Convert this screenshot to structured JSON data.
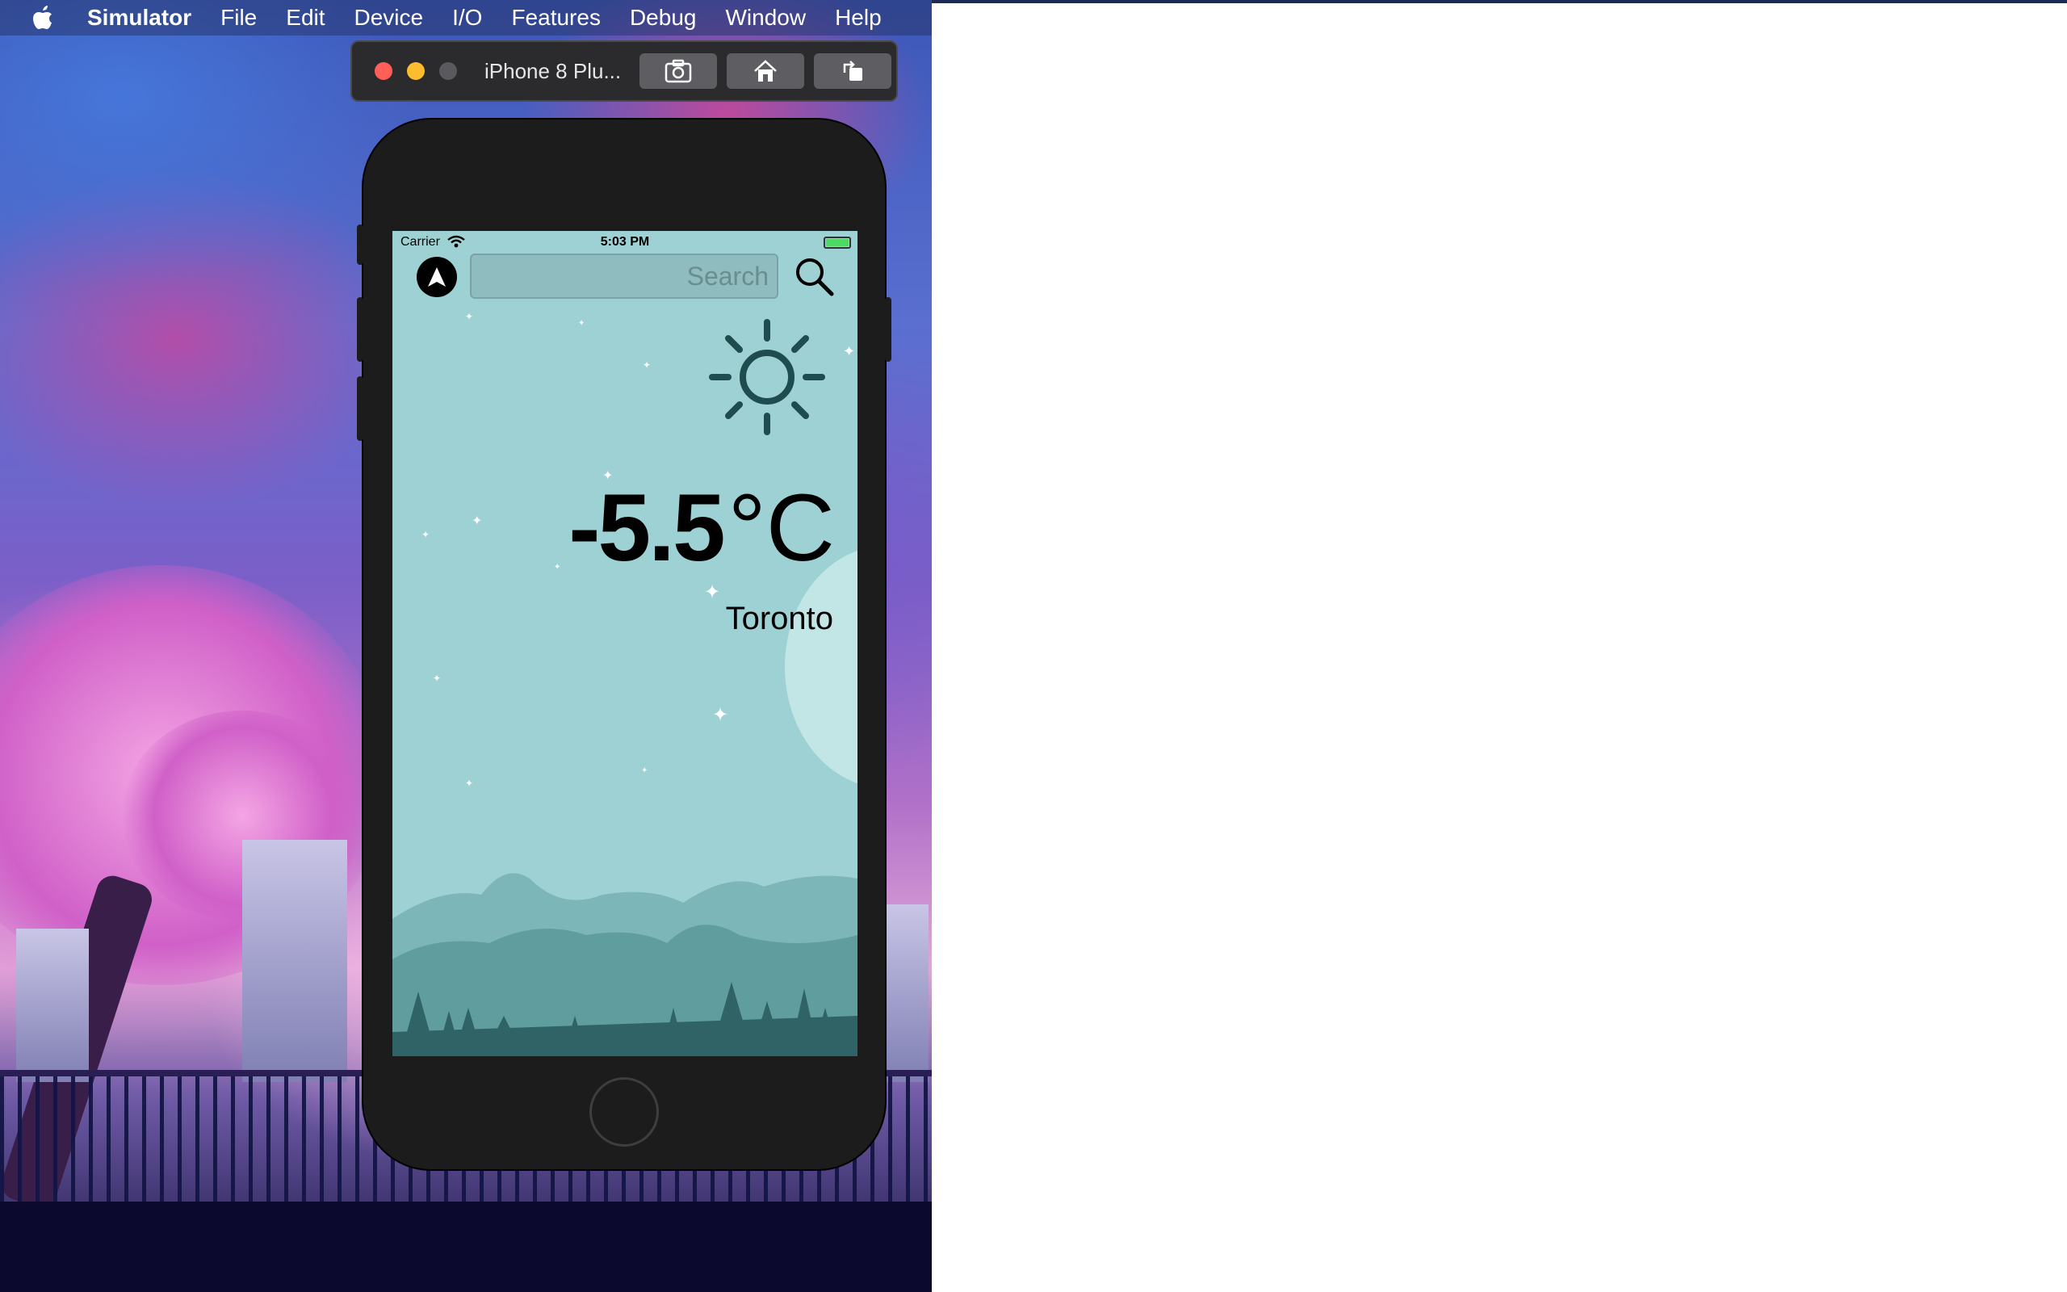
{
  "menubar": {
    "app_name": "Simulator",
    "items": [
      "File",
      "Edit",
      "Device",
      "I/O",
      "Features",
      "Debug",
      "Window",
      "Help"
    ]
  },
  "simulator": {
    "device_title": "iPhone 8 Plu...",
    "buttons": [
      "screenshot-icon",
      "home-icon",
      "rotate-icon"
    ]
  },
  "status_bar": {
    "carrier": "Carrier",
    "time": "5:03 PM"
  },
  "app": {
    "search_placeholder": "Search",
    "weather_icon": "sun-icon",
    "temperature_value": "-5.5",
    "temperature_unit": "°C",
    "city": "Toronto",
    "background_color": "#9dd1d3"
  }
}
